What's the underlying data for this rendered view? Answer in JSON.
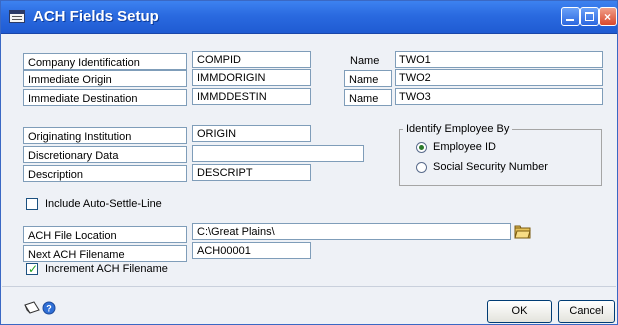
{
  "window": {
    "title": "ACH Fields Setup",
    "title_bar_color": "#2a6ae0"
  },
  "company": {
    "rows": [
      {
        "label": "Company Identification",
        "value": "COMPID",
        "name_label": "Name",
        "name_value": "TWO1"
      },
      {
        "label": "Immediate Origin",
        "value": "IMMDORIGIN",
        "name_label": "Name",
        "name_value": "TWO2"
      },
      {
        "label": "Immediate Destination",
        "value": "IMMDDESTIN",
        "name_label": "Name",
        "name_value": "TWO3"
      }
    ]
  },
  "institution": {
    "rows": [
      {
        "label": "Originating Institution",
        "value": "ORIGIN"
      },
      {
        "label": "Discretionary Data",
        "value": ""
      },
      {
        "label": "Description",
        "value": "DESCRIPT"
      }
    ]
  },
  "identify_employee": {
    "legend": "Identify Employee By",
    "options": [
      {
        "label": "Employee ID",
        "selected": true
      },
      {
        "label": "Social Security Number",
        "selected": false
      }
    ]
  },
  "auto_settle": {
    "label": "Include Auto-Settle-Line",
    "checked": false
  },
  "file": {
    "location_label": "ACH File Location",
    "location_value": "C:\\Great Plains\\",
    "next_label": "Next ACH Filename",
    "next_value": "ACH00001",
    "increment_label": "Increment ACH Filename",
    "increment_checked": true,
    "folder_icon": "folder-icon"
  },
  "buttons": {
    "ok": "OK",
    "cancel": "Cancel"
  },
  "footer_icons": [
    "note-icon",
    "help-icon"
  ]
}
